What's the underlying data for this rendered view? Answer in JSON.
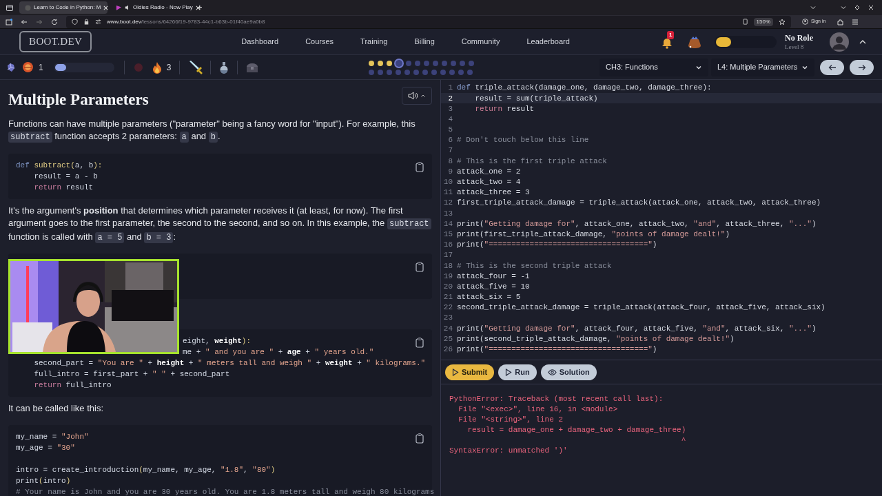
{
  "browser": {
    "tabs": [
      {
        "title": "Learn to Code in Python: M",
        "selected": true,
        "kind": "site"
      },
      {
        "title": "Oldies Radio - Now Play",
        "selected": false,
        "kind": "audio"
      }
    ],
    "new_tab": "+",
    "url": {
      "host": "www.boot.dev",
      "path": "/lessons/64266f19-9783-44c1-b63b-01f40ae9a0b8"
    },
    "zoom": "150%",
    "sign_in": "Sign in"
  },
  "header": {
    "logo": "BOOT.DEV",
    "nav": [
      "Dashboard",
      "Courses",
      "Training",
      "Billing",
      "Community",
      "Leaderboard"
    ],
    "notifications": "1",
    "xp": {
      "level": 0.25
    },
    "role": "No Role",
    "level": "Level 8"
  },
  "stats": {
    "gems": "1",
    "gem_bar": {
      "level": 0.2
    },
    "streak": "3"
  },
  "lesson_dots": [
    [
      {
        "kind": "done"
      },
      {
        "kind": "done"
      },
      {
        "kind": "done"
      },
      {
        "kind": "current"
      },
      {
        "kind": "todo"
      },
      {
        "kind": "todo"
      },
      {
        "kind": "todo"
      },
      {
        "kind": "todo"
      },
      {
        "kind": "todo"
      },
      {
        "kind": "todo"
      },
      {
        "kind": "todo"
      },
      {
        "kind": "todo"
      }
    ],
    [
      {
        "kind": "todo"
      },
      {
        "kind": "todo"
      },
      {
        "kind": "todo"
      },
      {
        "kind": "todo"
      },
      {
        "kind": "todo"
      },
      {
        "kind": "todo"
      },
      {
        "kind": "todo"
      },
      {
        "kind": "todo"
      },
      {
        "kind": "todo"
      },
      {
        "kind": "todo"
      },
      {
        "kind": "todo"
      },
      {
        "kind": "todo"
      }
    ]
  ],
  "chapter_select": "CH3: Functions",
  "lesson_select": "L4: Multiple Parameters",
  "lesson": {
    "title": "Multiple Parameters",
    "blocks": [
      {
        "kind": "paragraph",
        "segments": [
          {
            "kind": "text",
            "text": "Functions can have multiple parameters (\"parameter\" being a fancy word for \"input\"). For example, this "
          },
          {
            "kind": "code",
            "text": "subtract"
          },
          {
            "kind": "text",
            "text": " function accepts 2 parameters: "
          },
          {
            "kind": "code",
            "text": "a"
          },
          {
            "kind": "text",
            "text": " and "
          },
          {
            "kind": "code",
            "text": "b"
          },
          {
            "kind": "text",
            "text": "."
          }
        ]
      },
      {
        "kind": "code",
        "lines": [
          {
            "kind": "full",
            "segs": [
              {
                "kind": "def",
                "text": "def "
              },
              {
                "kind": "f",
                "text": "subtract("
              },
              {
                "kind": "p",
                "text": "a, b"
              },
              {
                "kind": "f",
                "text": "):"
              }
            ]
          },
          {
            "kind": "full",
            "segs": [
              {
                "kind": "p",
                "text": "    result = a - b"
              }
            ]
          },
          {
            "kind": "full",
            "segs": [
              {
                "kind": "kw",
                "text": "    return"
              },
              {
                "kind": "p",
                "text": " result"
              }
            ]
          }
        ]
      },
      {
        "kind": "paragraph",
        "segments": [
          {
            "kind": "text",
            "text": "It's the argument's **position** that determines which parameter receives it (at least, for now). The first argument goes to the first parameter, the second to the second, and so on. In this example, the "
          },
          {
            "kind": "code",
            "text": "subtract"
          },
          {
            "kind": "text",
            "text": " function is called with "
          },
          {
            "kind": "code",
            "text": "a = 5"
          },
          {
            "kind": "text",
            "text": " and "
          },
          {
            "kind": "code",
            "text": "b = 3"
          },
          {
            "kind": "text",
            "text": ":"
          }
        ]
      },
      {
        "kind": "code"
      },
      {
        "kind": "code",
        "lines": [
          {
            "kind": "partial",
            "segs": [
              {
                "kind": "p",
                "text": "eight, "
              },
              {
                "kind": "b",
                "text": "weight"
              },
              {
                "kind": "f",
                "text": "):"
              }
            ]
          },
          {
            "kind": "partial",
            "segs": [
              {
                "kind": "p",
                "text": "me + "
              },
              {
                "kind": "s",
                "text": "\" and you are \""
              },
              {
                "kind": "p",
                "text": " + "
              },
              {
                "kind": "b",
                "text": "age"
              },
              {
                "kind": "p",
                "text": " + "
              },
              {
                "kind": "s",
                "text": "\" years old.\""
              }
            ]
          },
          {
            "kind": "full",
            "segs": [
              {
                "kind": "p",
                "text": "    second_part = "
              },
              {
                "kind": "s",
                "text": "\"You are \""
              },
              {
                "kind": "p",
                "text": " + "
              },
              {
                "kind": "b",
                "text": "height"
              },
              {
                "kind": "p",
                "text": " + "
              },
              {
                "kind": "s",
                "text": "\" meters tall and weigh \""
              },
              {
                "kind": "p",
                "text": " + "
              },
              {
                "kind": "b",
                "text": "weight"
              },
              {
                "kind": "p",
                "text": " + "
              },
              {
                "kind": "s",
                "text": "\" kilograms.\""
              }
            ]
          },
          {
            "kind": "full",
            "segs": [
              {
                "kind": "p",
                "text": "    full_intro = first_part + "
              },
              {
                "kind": "s",
                "text": "\" \""
              },
              {
                "kind": "p",
                "text": " + second_part"
              }
            ]
          },
          {
            "kind": "full",
            "segs": [
              {
                "kind": "kw",
                "text": "    return"
              },
              {
                "kind": "p",
                "text": " full_intro"
              }
            ]
          }
        ]
      },
      {
        "kind": "paragraph",
        "segments": [
          {
            "kind": "text",
            "text": "It can be called like this:"
          }
        ]
      },
      {
        "kind": "code",
        "lines": [
          {
            "kind": "full",
            "segs": [
              {
                "kind": "p",
                "text": "my_name = "
              },
              {
                "kind": "s",
                "text": "\"John\""
              }
            ]
          },
          {
            "kind": "full",
            "segs": [
              {
                "kind": "p",
                "text": "my_age = "
              },
              {
                "kind": "s",
                "text": "\"30\""
              }
            ]
          },
          {
            "kind": "blank"
          },
          {
            "kind": "full",
            "segs": [
              {
                "kind": "p",
                "text": "intro = create_introduction"
              },
              {
                "kind": "f",
                "text": "("
              },
              {
                "kind": "p",
                "text": "my_name, my_age, "
              },
              {
                "kind": "s",
                "text": "\"1.8\""
              },
              {
                "kind": "p",
                "text": ", "
              },
              {
                "kind": "s",
                "text": "\"80\""
              },
              {
                "kind": "f",
                "text": ")"
              }
            ]
          },
          {
            "kind": "full",
            "segs": [
              {
                "kind": "p",
                "text": "print"
              },
              {
                "kind": "f",
                "text": "("
              },
              {
                "kind": "p",
                "text": "intro"
              },
              {
                "kind": "f",
                "text": ")"
              }
            ]
          },
          {
            "kind": "full",
            "segs": [
              {
                "kind": "c",
                "text": "# Your name is John and you are 30 years old. You are 1.8 meters tall and weigh 80 kilograms"
              }
            ]
          }
        ]
      }
    ]
  },
  "editor": {
    "lines": [
      {
        "n": "1",
        "active": false,
        "segs": [
          {
            "kind": "def",
            "text": "def "
          },
          {
            "kind": "p",
            "text": "triple_attack(damage_one, damage_two, damage_three):"
          }
        ]
      },
      {
        "n": "2",
        "active": true,
        "segs": [
          {
            "kind": "p",
            "text": "    result = sum(triple_attack)"
          }
        ]
      },
      {
        "n": "3",
        "active": false,
        "segs": [
          {
            "kind": "kw",
            "text": "    return"
          },
          {
            "kind": "p",
            "text": " result"
          }
        ]
      },
      {
        "n": "4",
        "active": false
      },
      {
        "n": "5",
        "active": false
      },
      {
        "n": "6",
        "active": false,
        "segs": [
          {
            "kind": "c",
            "text": "# Don't touch below this line"
          }
        ]
      },
      {
        "n": "7",
        "active": false
      },
      {
        "n": "8",
        "active": false,
        "segs": [
          {
            "kind": "c",
            "text": "# This is the first triple attack"
          }
        ]
      },
      {
        "n": "9",
        "active": false,
        "segs": [
          {
            "kind": "p",
            "text": "attack_one = 2"
          }
        ]
      },
      {
        "n": "10",
        "active": false,
        "segs": [
          {
            "kind": "p",
            "text": "attack_two = 4"
          }
        ]
      },
      {
        "n": "11",
        "active": false,
        "segs": [
          {
            "kind": "p",
            "text": "attack_three = 3"
          }
        ]
      },
      {
        "n": "12",
        "active": false,
        "segs": [
          {
            "kind": "p",
            "text": "first_triple_attack_damage = triple_attack(attack_one, attack_two, attack_three)"
          }
        ]
      },
      {
        "n": "13",
        "active": false
      },
      {
        "n": "14",
        "active": false,
        "segs": [
          {
            "kind": "p",
            "text": "print("
          },
          {
            "kind": "s",
            "text": "\"Getting damage for\""
          },
          {
            "kind": "p",
            "text": ", attack_one, attack_two, "
          },
          {
            "kind": "s",
            "text": "\"and\""
          },
          {
            "kind": "p",
            "text": ", attack_three, "
          },
          {
            "kind": "s",
            "text": "\"...\""
          },
          {
            "kind": "p",
            "text": ")"
          }
        ]
      },
      {
        "n": "15",
        "active": false,
        "segs": [
          {
            "kind": "p",
            "text": "print(first_triple_attack_damage, "
          },
          {
            "kind": "s",
            "text": "\"points of damage dealt!\""
          },
          {
            "kind": "p",
            "text": ")"
          }
        ]
      },
      {
        "n": "16",
        "active": false,
        "segs": [
          {
            "kind": "p",
            "text": "print("
          },
          {
            "kind": "s",
            "text": "\"===================================\""
          },
          {
            "kind": "p",
            "text": ")"
          }
        ]
      },
      {
        "n": "17",
        "active": false
      },
      {
        "n": "18",
        "active": false,
        "segs": [
          {
            "kind": "c",
            "text": "# This is the second triple attack"
          }
        ]
      },
      {
        "n": "19",
        "active": false,
        "segs": [
          {
            "kind": "p",
            "text": "attack_four = -1"
          }
        ]
      },
      {
        "n": "20",
        "active": false,
        "segs": [
          {
            "kind": "p",
            "text": "attack_five = 10"
          }
        ]
      },
      {
        "n": "21",
        "active": false,
        "segs": [
          {
            "kind": "p",
            "text": "attack_six = 5"
          }
        ]
      },
      {
        "n": "22",
        "active": false,
        "segs": [
          {
            "kind": "p",
            "text": "second_triple_attack_damage = triple_attack(attack_four, attack_five, attack_six)"
          }
        ]
      },
      {
        "n": "23",
        "active": false
      },
      {
        "n": "24",
        "active": false,
        "segs": [
          {
            "kind": "p",
            "text": "print("
          },
          {
            "kind": "s",
            "text": "\"Getting damage for\""
          },
          {
            "kind": "p",
            "text": ", attack_four, attack_five, "
          },
          {
            "kind": "s",
            "text": "\"and\""
          },
          {
            "kind": "p",
            "text": ", attack_six, "
          },
          {
            "kind": "s",
            "text": "\"...\""
          },
          {
            "kind": "p",
            "text": ")"
          }
        ]
      },
      {
        "n": "25",
        "active": false,
        "segs": [
          {
            "kind": "p",
            "text": "print(second_triple_attack_damage, "
          },
          {
            "kind": "s",
            "text": "\"points of damage dealt!\""
          },
          {
            "kind": "p",
            "text": ")"
          }
        ]
      },
      {
        "n": "26",
        "active": false,
        "segs": [
          {
            "kind": "p",
            "text": "print("
          },
          {
            "kind": "s",
            "text": "\"===================================\""
          },
          {
            "kind": "p",
            "text": ")"
          }
        ]
      }
    ]
  },
  "actions": [
    {
      "label": "Submit",
      "kind": "submit"
    },
    {
      "label": "Run",
      "kind": "run"
    },
    {
      "label": "Solution",
      "kind": "solution"
    }
  ],
  "output": [
    "PythonError: Traceback (most recent call last):",
    "  File \"<exec>\", line 16, in <module>",
    "  File \"<string>\", line 2",
    "    result = damage_one + damage_two + damage_three)",
    "                                                   ^",
    "SyntaxError: unmatched ')'"
  ]
}
